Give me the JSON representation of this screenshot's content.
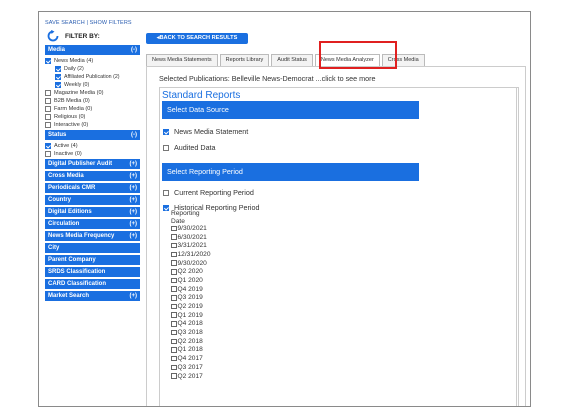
{
  "sidebar": {
    "top_links": {
      "save": "SAVE SEARCH",
      "sep": " | ",
      "show": "SHOW FILTERS"
    },
    "filter_by": "FILTER BY:",
    "sections": [
      {
        "label": "Media",
        "toggle": "(-)",
        "options": [
          {
            "label": "News Media",
            "count": "(4)",
            "checked": true,
            "level": 0
          },
          {
            "label": "Daily",
            "count": "(2)",
            "checked": true,
            "level": 1
          },
          {
            "label": "Affiliated Publication",
            "count": "(2)",
            "checked": true,
            "level": 1
          },
          {
            "label": "Weekly",
            "count": "(0)",
            "checked": true,
            "level": 1
          },
          {
            "label": "Magazine Media",
            "count": "(0)",
            "checked": false,
            "level": 0
          },
          {
            "label": "B2B Media",
            "count": "(0)",
            "checked": false,
            "level": 0
          },
          {
            "label": "Farm Media",
            "count": "(0)",
            "checked": false,
            "level": 0
          },
          {
            "label": "Religious",
            "count": "(0)",
            "checked": false,
            "level": 0
          },
          {
            "label": "Interactive",
            "count": "(0)",
            "checked": false,
            "level": 0
          }
        ]
      },
      {
        "label": "Status",
        "toggle": "(-)",
        "options": [
          {
            "label": "Active",
            "count": "(4)",
            "checked": true,
            "level": 0
          },
          {
            "label": "Inactive",
            "count": "(0)",
            "checked": false,
            "level": 0
          }
        ]
      },
      {
        "label": "Digital Publisher Audit",
        "toggle": "(+)",
        "options": []
      },
      {
        "label": "Cross Media",
        "toggle": "(+)",
        "options": []
      },
      {
        "label": "Periodicals CMR",
        "toggle": "(+)",
        "options": []
      },
      {
        "label": "Country",
        "toggle": "(+)",
        "options": []
      },
      {
        "label": "Digital Editions",
        "toggle": "(+)",
        "options": []
      },
      {
        "label": "Circulation",
        "toggle": "(+)",
        "options": []
      },
      {
        "label": "News Media Frequency",
        "toggle": "(+)",
        "options": []
      },
      {
        "label": "City",
        "toggle": "",
        "options": []
      },
      {
        "label": "Parent Company",
        "toggle": "",
        "options": []
      },
      {
        "label": "SRDS Classification",
        "toggle": "",
        "options": []
      },
      {
        "label": "CARD Classification",
        "toggle": "",
        "options": []
      },
      {
        "label": "Market Search",
        "toggle": "(+)",
        "options": []
      }
    ]
  },
  "back_button": "◂BACK TO SEARCH RESULTS",
  "tabs": [
    {
      "label": "News Media Statements",
      "active": false
    },
    {
      "label": "Reports Library",
      "active": false
    },
    {
      "label": "Audit Status",
      "active": false
    },
    {
      "label": "News Media Analyzer",
      "active": true
    },
    {
      "label": "Cross Media",
      "active": false
    }
  ],
  "selected_pubs": {
    "label": "Selected Publications:",
    "value": "Belleville News-Democrat",
    "more": "...click to see more"
  },
  "standard_reports": "Standard Reports",
  "data_source": {
    "header": "Select Data Source",
    "options": [
      {
        "label": "News Media Statement",
        "checked": true
      },
      {
        "label": "Audited Data",
        "checked": false
      }
    ]
  },
  "reporting_period": {
    "header": "Select Reporting Period",
    "options": [
      {
        "label": "Current Reporting Period",
        "checked": false
      },
      {
        "label": "Historical Reporting Period",
        "checked": true
      }
    ],
    "reporting_label": "Reporting",
    "date_label": "Date",
    "dates": [
      "9/30/2021",
      "6/30/2021",
      "3/31/2021",
      "12/31/2020",
      "9/30/2020",
      "Q2 2020",
      "Q1 2020",
      "Q4 2019",
      "Q3 2019",
      "Q2 2019",
      "Q1 2019",
      "Q4 2018",
      "Q3 2018",
      "Q2 2018",
      "Q1 2018",
      "Q4 2017",
      "Q3 2017",
      "Q2 2017"
    ]
  },
  "colors": {
    "accent": "#1a6fe0",
    "highlight": "#e02020"
  }
}
